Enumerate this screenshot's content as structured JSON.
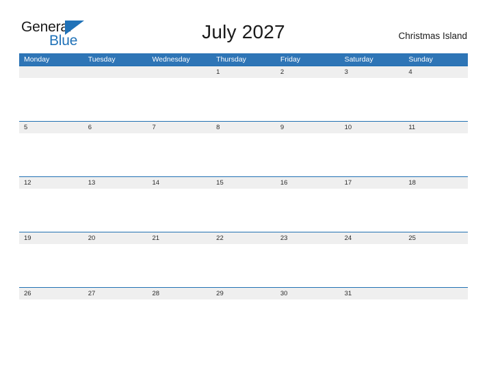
{
  "brand": {
    "name_part1": "General",
    "name_part2": "Blue",
    "flag_color": "#2072b8"
  },
  "header": {
    "title": "July 2027",
    "location": "Christmas Island"
  },
  "calendar": {
    "accent_color": "#2e75b6",
    "rule_color": "#1f6fb2",
    "date_strip_color": "#efefef",
    "weekdays": [
      "Monday",
      "Tuesday",
      "Wednesday",
      "Thursday",
      "Friday",
      "Saturday",
      "Sunday"
    ],
    "weeks": [
      [
        "",
        "",
        "",
        "1",
        "2",
        "3",
        "4"
      ],
      [
        "5",
        "6",
        "7",
        "8",
        "9",
        "10",
        "11"
      ],
      [
        "12",
        "13",
        "14",
        "15",
        "16",
        "17",
        "18"
      ],
      [
        "19",
        "20",
        "21",
        "22",
        "23",
        "24",
        "25"
      ],
      [
        "26",
        "27",
        "28",
        "29",
        "30",
        "31",
        ""
      ]
    ]
  }
}
